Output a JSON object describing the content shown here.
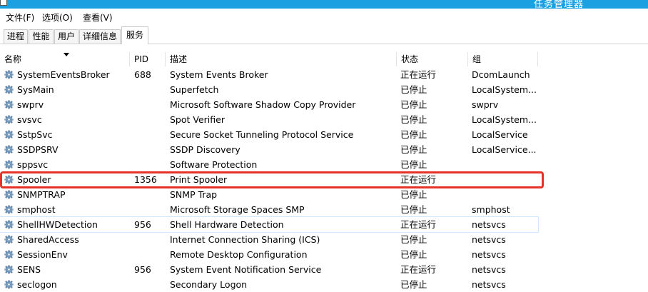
{
  "window": {
    "title": "任务管理器"
  },
  "menu": [
    {
      "label": "文件(F)"
    },
    {
      "label": "选项(O)"
    },
    {
      "label": "查看(V)"
    }
  ],
  "tabs": [
    {
      "label": "进程"
    },
    {
      "label": "性能"
    },
    {
      "label": "用户"
    },
    {
      "label": "详细信息"
    },
    {
      "label": "服务",
      "active": true
    }
  ],
  "table": {
    "columns": [
      "名称",
      "PID",
      "描述",
      "状态",
      "组"
    ],
    "sort_column": "名称",
    "rows": [
      {
        "name": "SystemEventsBroker",
        "pid": "688",
        "desc": "System Events Broker",
        "status": "正在运行",
        "group": "DcomLaunch"
      },
      {
        "name": "SysMain",
        "pid": "",
        "desc": "Superfetch",
        "status": "已停止",
        "group": "LocalSystem..."
      },
      {
        "name": "swprv",
        "pid": "",
        "desc": "Microsoft Software Shadow Copy Provider",
        "status": "已停止",
        "group": "swprv"
      },
      {
        "name": "svsvc",
        "pid": "",
        "desc": "Spot Verifier",
        "status": "已停止",
        "group": "LocalSystem..."
      },
      {
        "name": "SstpSvc",
        "pid": "",
        "desc": "Secure Socket Tunneling Protocol Service",
        "status": "已停止",
        "group": "LocalService"
      },
      {
        "name": "SSDPSRV",
        "pid": "",
        "desc": "SSDP Discovery",
        "status": "已停止",
        "group": "LocalService..."
      },
      {
        "name": "sppsvc",
        "pid": "",
        "desc": "Software Protection",
        "status": "已停止",
        "group": ""
      },
      {
        "name": "Spooler",
        "pid": "1356",
        "desc": "Print Spooler",
        "status": "正在运行",
        "group": "",
        "highlighted": true
      },
      {
        "name": "SNMPTRAP",
        "pid": "",
        "desc": "SNMP Trap",
        "status": "已停止",
        "group": ""
      },
      {
        "name": "smphost",
        "pid": "",
        "desc": "Microsoft Storage Spaces SMP",
        "status": "已停止",
        "group": "smphost"
      },
      {
        "name": "ShellHWDetection",
        "pid": "956",
        "desc": "Shell Hardware Detection",
        "status": "正在运行",
        "group": "netsvcs",
        "selected": true
      },
      {
        "name": "SharedAccess",
        "pid": "",
        "desc": "Internet Connection Sharing (ICS)",
        "status": "已停止",
        "group": "netsvcs"
      },
      {
        "name": "SessionEnv",
        "pid": "",
        "desc": "Remote Desktop Configuration",
        "status": "已停止",
        "group": "netsvcs"
      },
      {
        "name": "SENS",
        "pid": "956",
        "desc": "System Event Notification Service",
        "status": "正在运行",
        "group": "netsvcs"
      },
      {
        "name": "seclogon",
        "pid": "",
        "desc": "Secondary Logon",
        "status": "已停止",
        "group": "netsvcs"
      }
    ]
  },
  "colors": {
    "titlebar": "#1ba1e2",
    "highlight_border": "#e63228",
    "selection_outline": "#cde8ff"
  },
  "icons": {
    "service": "gear-icon"
  }
}
